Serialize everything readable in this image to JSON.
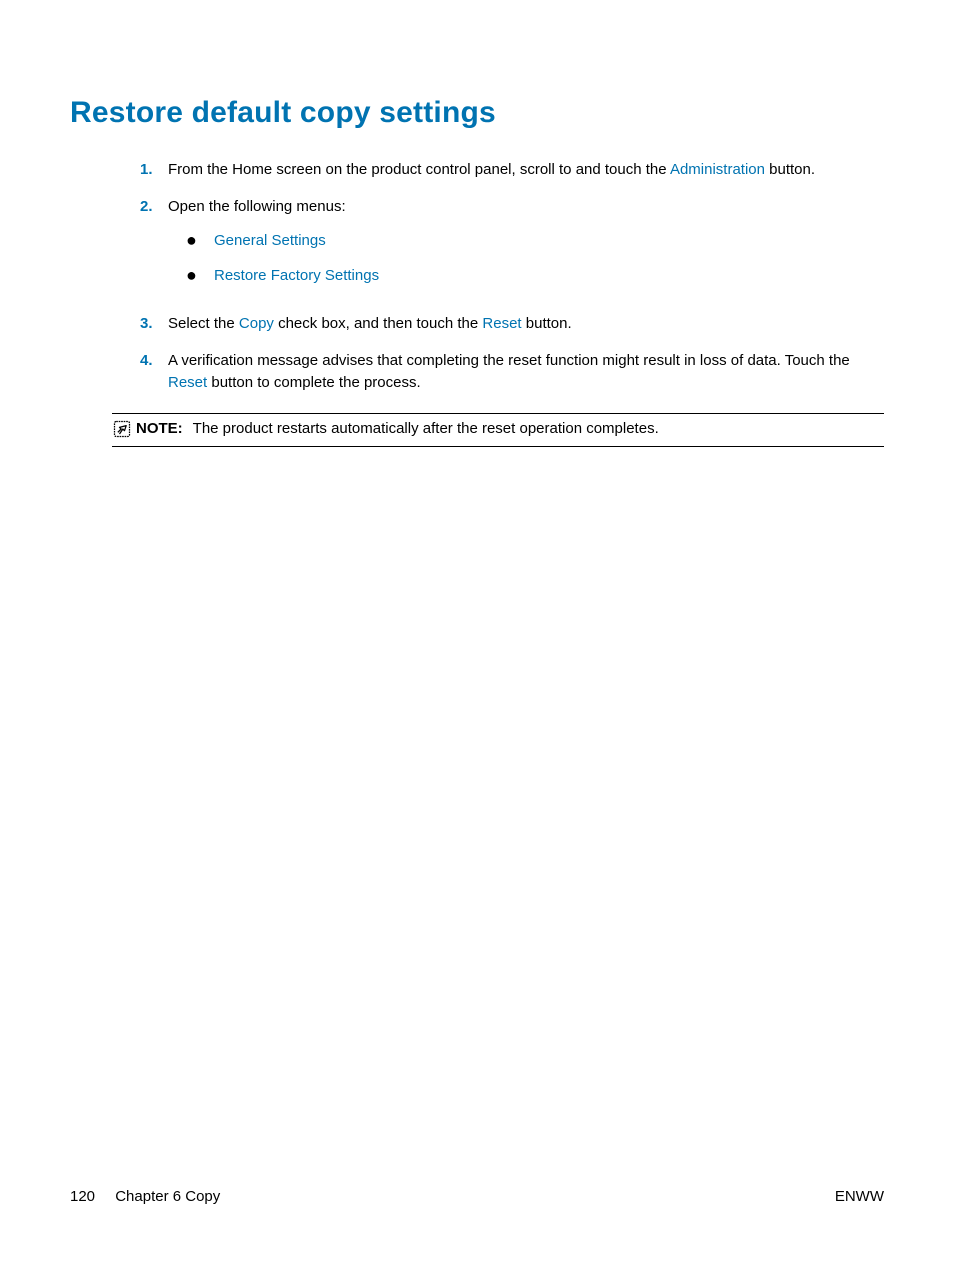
{
  "heading": "Restore default copy settings",
  "steps": {
    "s1": {
      "num": "1.",
      "pre": "From the Home screen on the product control panel, scroll to and touch the ",
      "link": "Administration",
      "post": " button."
    },
    "s2": {
      "num": "2.",
      "text": "Open the following menus:",
      "sub1": "General Settings",
      "sub2": "Restore Factory Settings"
    },
    "s3": {
      "num": "3.",
      "pre": "Select the ",
      "link1": "Copy",
      "mid": " check box, and then touch the ",
      "link2": "Reset",
      "post": " button."
    },
    "s4": {
      "num": "4.",
      "pre": "A verification message advises that completing the reset function might result in loss of data. Touch the ",
      "link": "Reset",
      "post": " button to complete the process."
    }
  },
  "note": {
    "label": "NOTE:",
    "text": "The product restarts automatically after the reset operation completes."
  },
  "footer": {
    "page": "120",
    "chapter": "Chapter 6   Copy",
    "lang": "ENWW"
  }
}
